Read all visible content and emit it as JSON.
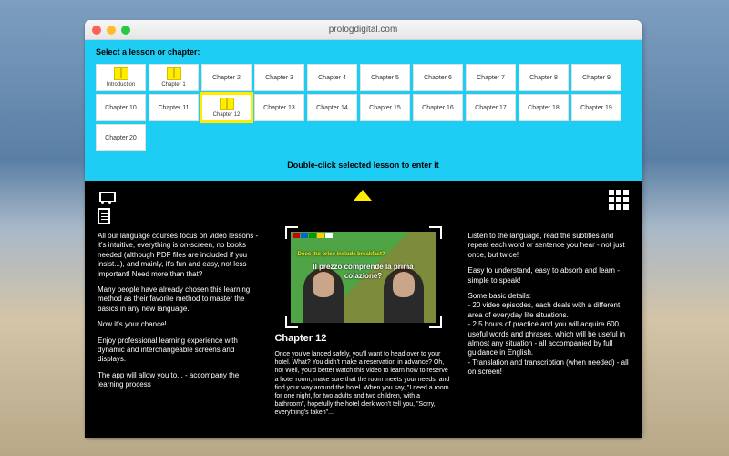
{
  "window": {
    "title": "prologdigital.com"
  },
  "selector": {
    "label": "Select a lesson or chapter:",
    "hint": "Double-click selected lesson to enter it",
    "chapters": [
      {
        "label": "Introduction",
        "gift": true,
        "selected": false
      },
      {
        "label": "Chapter 1",
        "gift": true,
        "selected": false
      },
      {
        "label": "Chapter 2",
        "gift": false,
        "selected": false
      },
      {
        "label": "Chapter 3",
        "gift": false,
        "selected": false
      },
      {
        "label": "Chapter 4",
        "gift": false,
        "selected": false
      },
      {
        "label": "Chapter 5",
        "gift": false,
        "selected": false
      },
      {
        "label": "Chapter 6",
        "gift": false,
        "selected": false
      },
      {
        "label": "Chapter 7",
        "gift": false,
        "selected": false
      },
      {
        "label": "Chapter 8",
        "gift": false,
        "selected": false
      },
      {
        "label": "Chapter 9",
        "gift": false,
        "selected": false
      },
      {
        "label": "Chapter 10",
        "gift": false,
        "selected": false
      },
      {
        "label": "Chapter 11",
        "gift": false,
        "selected": false
      },
      {
        "label": "Chapter 12",
        "gift": true,
        "selected": true
      },
      {
        "label": "Chapter 13",
        "gift": false,
        "selected": false
      },
      {
        "label": "Chapter 14",
        "gift": false,
        "selected": false
      },
      {
        "label": "Chapter 15",
        "gift": false,
        "selected": false
      },
      {
        "label": "Chapter 16",
        "gift": false,
        "selected": false
      },
      {
        "label": "Chapter 17",
        "gift": false,
        "selected": false
      },
      {
        "label": "Chapter 18",
        "gift": false,
        "selected": false
      },
      {
        "label": "Chapter 19",
        "gift": false,
        "selected": false
      },
      {
        "label": "Chapter 20",
        "gift": false,
        "selected": false
      }
    ]
  },
  "content": {
    "left": {
      "p1": "All our language courses focus on video lessons - it's intuitive, everything is on-screen, no books needed (although PDF files are included if you insist...), and mainly, it's fun and easy, not less important! Need more than that?",
      "p2": "Many people have already chosen this learning method as their favorite method to master the basics in any new language.",
      "p3": "Now it's your chance!",
      "p4": "Enjoy professional learning experience with dynamic and interchangeable screens and displays.",
      "p5": "The app will allow you to...\n- accompany the learning process"
    },
    "mid": {
      "yellow_caption": "Does the price include breakfast?",
      "italian_caption": "Il prezzo comprende la prima colazione?",
      "chapter_title": "Chapter 12",
      "body": "Once you've landed safely, you'll want to head over to your hotel. What? You didn't make a reservation in advance? Oh, no! Well, you'd better watch this video to learn how to reserve a hotel room, make sure that the room meets your needs, and find your way around the hotel. When you say, \"I need a room for one night, for two adults and two children, with a bathroom\", hopefully the hotel clerk won't tell you, \"Sorry, everything's taken\"..."
    },
    "right": {
      "p1": "Listen to the language, read the subtitles and repeat each word or sentence you hear - not just once, but twice!",
      "p2": "Easy to understand, easy to absorb and learn - simple to speak!",
      "p3": "Some basic details:\n- 20 video episodes, each deals with a different area of everyday life situations.\n- 2.5 hours of practice and you will acquire 600 useful words and phrases, which will be useful in almost any situation - all accompanied by full guidance in English.\n- Translation and transcription (when needed) - all on screen!"
    }
  },
  "colors": {
    "accent_cyan": "#1ecdf4",
    "accent_yellow": "#ffec00"
  }
}
